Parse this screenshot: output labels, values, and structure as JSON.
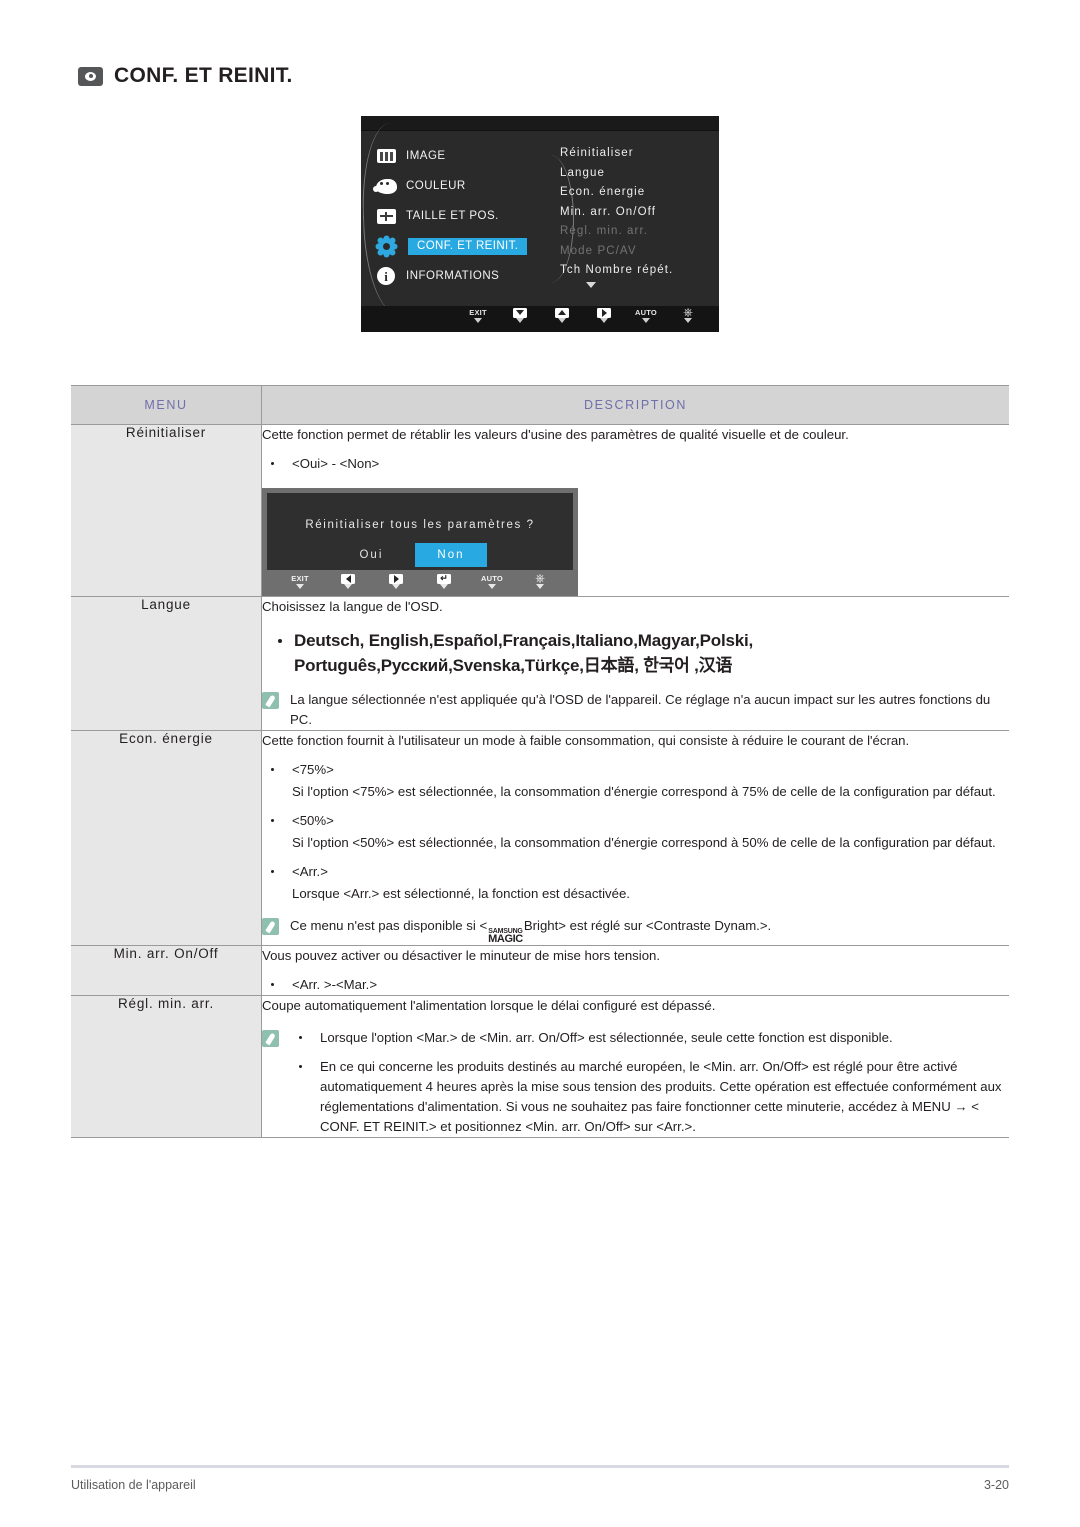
{
  "page": {
    "title": "CONF. ET REINIT.",
    "title_icon": "monitor-eye-icon"
  },
  "osd": {
    "left_menu": [
      {
        "label": "IMAGE",
        "icon": "image-icon",
        "selected": false
      },
      {
        "label": "COULEUR",
        "icon": "color-palette-icon",
        "selected": false
      },
      {
        "label": "TAILLE ET POS.",
        "icon": "size-position-icon",
        "selected": false
      },
      {
        "label": "CONF. ET REINIT.",
        "icon": "gear-icon",
        "selected": true
      },
      {
        "label": "INFORMATIONS",
        "icon": "info-icon",
        "selected": false
      }
    ],
    "right_menu": [
      {
        "label": "Réinitialiser",
        "dim": false
      },
      {
        "label": "Langue",
        "dim": false
      },
      {
        "label": "Econ. énergie",
        "dim": false
      },
      {
        "label": "Min. arr. On/Off",
        "dim": false
      },
      {
        "label": "Régl. min. arr.",
        "dim": true
      },
      {
        "label": "Mode PC/AV",
        "dim": true
      },
      {
        "label": "Tch Nombre répét.",
        "dim": false
      }
    ],
    "buttons": [
      {
        "label": "EXIT",
        "glyph": "none"
      },
      {
        "label": "",
        "glyph": "down"
      },
      {
        "label": "",
        "glyph": "up"
      },
      {
        "label": "",
        "glyph": "right"
      },
      {
        "label": "AUTO",
        "glyph": "none"
      },
      {
        "label": "",
        "glyph": "power"
      }
    ],
    "accent_color": "#29a9e1"
  },
  "table": {
    "headers": {
      "menu": "MENU",
      "description": "DESCRIPTION"
    },
    "header_text_color": "#6f6fab",
    "rows": {
      "reinitialiser": {
        "menu": "Réinitialiser",
        "intro": "Cette fonction permet de rétablir les valeurs d'usine des paramètres de qualité visuelle et de couleur.",
        "bullet": "<Oui> - <Non>"
      },
      "langue": {
        "menu": "Langue",
        "intro": "Choisissez la langue de l'OSD.",
        "languages_line1": "Deutsch, English,Español,Français,Italiano,Magyar,Polski,",
        "languages_line2": "Português,Русский,Svenska,Türkçe,日本語, 한국어 ,汉语",
        "note": "La langue sélectionnée n'est appliquée qu'à l'OSD de l'appareil. Ce réglage n'a aucun impact sur les autres fonctions du PC."
      },
      "econ_energie": {
        "menu": "Econ. énergie",
        "intro": "Cette fonction fournit à l'utilisateur un mode à faible consommation, qui consiste à réduire le courant de l'écran.",
        "b1": "<75%>",
        "b1_sub": "Si l'option <75%> est sélectionnée, la consommation d'énergie correspond à 75% de celle de la configuration par défaut.",
        "b2": "<50%>",
        "b2_sub": "Si l'option <50%> est sélectionnée, la consommation d'énergie correspond à 50% de celle de la configuration par défaut.",
        "b3": "<Arr.>",
        "b3_sub": "Lorsque <Arr.> est sélectionné, la fonction est désactivée.",
        "note_pre": "Ce menu n'est pas disponible si <",
        "note_logo_top": "SAMSUNG",
        "note_logo_bottom": "MAGIC",
        "note_post": "Bright> est réglé sur <Contraste Dynam.>."
      },
      "min_arr_onoff": {
        "menu": "Min. arr. On/Off",
        "intro": "Vous pouvez activer ou désactiver le minuteur de mise hors tension.",
        "bullet": "<Arr. >-<Mar.>"
      },
      "regl_min_arr": {
        "menu": "Régl. min. arr.",
        "intro": "Coupe automatiquement l'alimentation lorsque le délai configuré est dépassé.",
        "note_b1": "Lorsque l'option <Mar.> de <Min. arr. On/Off> est sélectionnée, seule cette fonction est disponible.",
        "note_b2": "En ce qui concerne les produits destinés au marché européen, le <Min. arr. On/Off> est réglé pour être activé automatiquement 4 heures après la mise sous tension des produits. Cette opération est effectuée conformément aux réglementations d'alimentation. Si vous ne souhaitez pas faire fonctionner cette minuterie, accédez à MENU → < CONF. ET REINIT.> et positionnez <Min. arr. On/Off> sur <Arr.>."
      }
    }
  },
  "dialog": {
    "question": "Réinitialiser tous les paramètres ?",
    "yes": "Oui",
    "no": "Non",
    "selected": "Non",
    "buttons": [
      {
        "label": "EXIT",
        "glyph": "none"
      },
      {
        "label": "",
        "glyph": "left"
      },
      {
        "label": "",
        "glyph": "right"
      },
      {
        "label": "",
        "glyph": "enter"
      },
      {
        "label": "AUTO",
        "glyph": "none"
      },
      {
        "label": "",
        "glyph": "power"
      }
    ]
  },
  "footer": {
    "left": "Utilisation de l'appareil",
    "right": "3-20"
  }
}
